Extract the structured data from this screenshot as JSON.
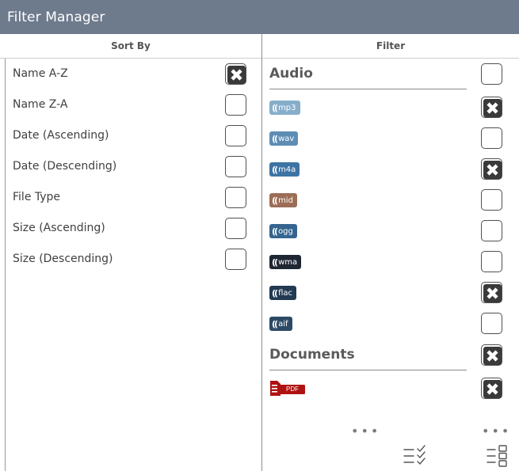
{
  "window": {
    "title": "Filter Manager"
  },
  "headers": {
    "sort": "Sort By",
    "filter": "Filter"
  },
  "sort_options": [
    {
      "label": "Name A-Z",
      "checked": true
    },
    {
      "label": "Name Z-A",
      "checked": false
    },
    {
      "label": "Date (Ascending)",
      "checked": false
    },
    {
      "label": "Date (Descending)",
      "checked": false
    },
    {
      "label": "File Type",
      "checked": false
    },
    {
      "label": "Size (Ascending)",
      "checked": false
    },
    {
      "label": "Size (Descending)",
      "checked": false
    }
  ],
  "filter_groups": [
    {
      "title": "Audio",
      "checked": false,
      "items": [
        {
          "ext": "mp3",
          "color": "#86aecb",
          "checked": true
        },
        {
          "ext": "wav",
          "color": "#5e8db4",
          "checked": false
        },
        {
          "ext": "m4a",
          "color": "#3e74a4",
          "checked": true
        },
        {
          "ext": "mid",
          "color": "#9c6d56",
          "checked": false
        },
        {
          "ext": "ogg",
          "color": "#35658f",
          "checked": false
        },
        {
          "ext": "wma",
          "color": "#1f2733",
          "checked": false
        },
        {
          "ext": "flac",
          "color": "#223a52",
          "checked": true
        },
        {
          "ext": "aif",
          "color": "#2c4a66",
          "checked": false
        }
      ]
    },
    {
      "title": "Documents",
      "checked": true,
      "items": [
        {
          "ext": "PDF",
          "color": "#b01212",
          "checked": true
        }
      ]
    }
  ],
  "more": {
    "label": "•••"
  },
  "icons": {
    "checklist": "checklist-icon",
    "list_grid": "list-grid-icon"
  }
}
